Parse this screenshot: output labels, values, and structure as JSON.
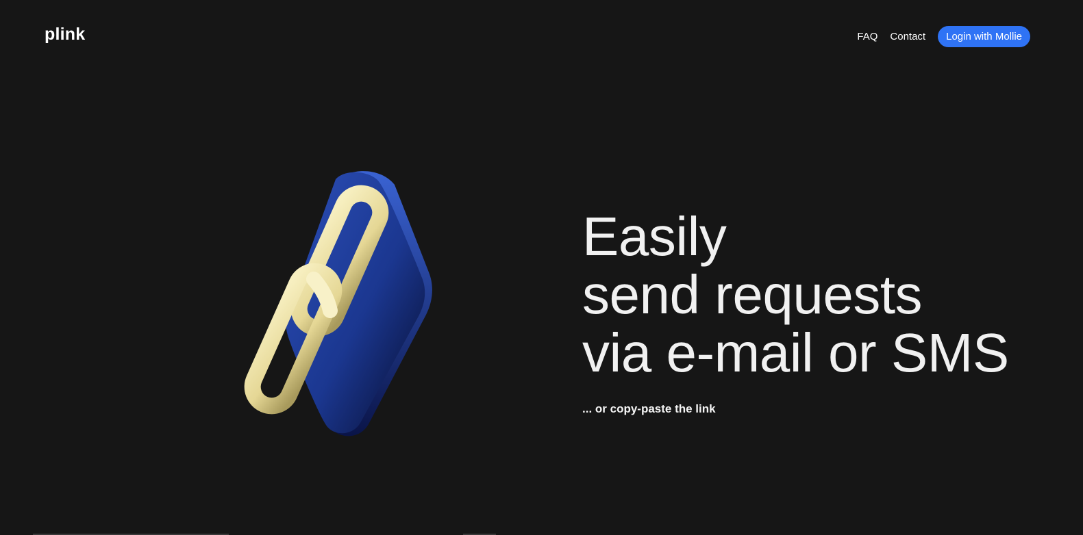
{
  "header": {
    "logo": "plink",
    "nav": {
      "faq": "FAQ",
      "contact": "Contact",
      "login": "Login with Mollie"
    }
  },
  "hero": {
    "headline_lines": [
      "Easily",
      "send requests",
      "via e-mail or SMS"
    ],
    "subline": "... or copy-paste the link",
    "illustration": "chain-link-icon"
  },
  "colors": {
    "background": "#161616",
    "accent": "#2f73f5",
    "tile_blue": "#1d3d9a",
    "chain_cream": "#ebe0a1"
  }
}
